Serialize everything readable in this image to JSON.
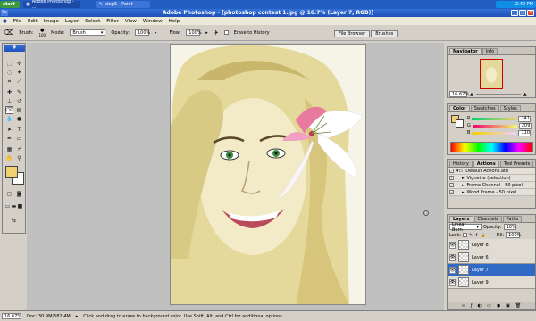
{
  "taskbar": {
    "start_label": "start",
    "tasks": [
      {
        "label": "Adobe Photoshop - ...",
        "active": true
      },
      {
        "label": "step5 - Paint",
        "active": false
      }
    ],
    "clock": "2:42 PM"
  },
  "window": {
    "title": "Adobe Photoshop - [photoshop contest 1.jpg @ 16.7% (Layer 7, RGB)]"
  },
  "menu": [
    "File",
    "Edit",
    "Image",
    "Layer",
    "Select",
    "Filter",
    "View",
    "Window",
    "Help"
  ],
  "options": {
    "brush_label": "Brush:",
    "brush_size": "100",
    "mode_label": "Mode:",
    "mode_value": "Brush",
    "opacity_label": "Opacity:",
    "opacity_value": "100%",
    "flow_label": "Flow:",
    "flow_value": "100%",
    "erase_history": "Erase to History",
    "palette_tabs": [
      "File Browser",
      "Brushes"
    ]
  },
  "navigator": {
    "tabs": [
      "Navigator",
      "Info"
    ],
    "zoom": "16.67%"
  },
  "color": {
    "tabs": [
      "Color",
      "Swatches",
      "Styles"
    ],
    "channels": [
      {
        "name": "R",
        "value": "241"
      },
      {
        "name": "G",
        "value": "209"
      },
      {
        "name": "B",
        "value": "110"
      }
    ],
    "foreground": "#f0d070"
  },
  "actions": {
    "tabs": [
      "History",
      "Actions",
      "Tool Presets"
    ],
    "items": [
      "Default Actions.atn",
      "Vignette (selection)",
      "Frame Channel - 50 pixel",
      "Wood Frame - 50 pixel"
    ]
  },
  "layers": {
    "tabs": [
      "Layers",
      "Channels",
      "Paths"
    ],
    "blend_mode": "Linear Burn",
    "opacity_label": "Opacity:",
    "opacity_value": "10%",
    "lock_label": "Lock:",
    "fill_label": "Fill:",
    "fill_value": "100%",
    "items": [
      "Layer 8",
      "Layer 6",
      "Layer 7",
      "Layer 9"
    ],
    "selected_index": 2
  },
  "status": {
    "zoom": "16.67%",
    "doc": "Doc: 30.9M/582.4M",
    "hint": "Click and drag to erase to background color. Use Shift, Alt, and Ctrl for additional options."
  }
}
